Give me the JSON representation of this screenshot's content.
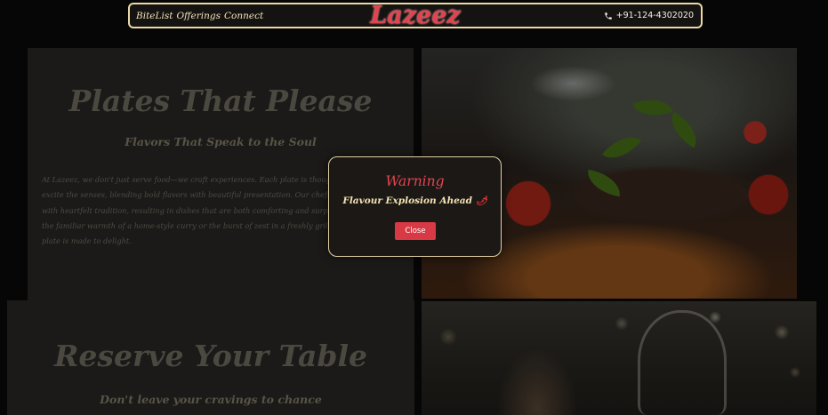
{
  "nav": {
    "links": [
      "BiteList",
      "Offerings",
      "Connect"
    ],
    "logo": "Lazeez",
    "phone": "+91-124-4302020"
  },
  "about": {
    "title": "Plates That Please",
    "subtitle": "Flavors That Speak to the Soul",
    "paragraph": "At Lazeez, we don't just serve food—we craft experiences. Each plate is thoughtfully prepared to excite the senses, blending bold flavors with beautiful presentation. Our chefs combine creativity with heartfelt tradition, resulting in dishes that are both comforting and surprising. Whether it's the familiar warmth of a home-style curry or the burst of zest in a freshly grilled appetizer, every plate is made to delight."
  },
  "reserve": {
    "title": "Reserve Your Table",
    "subtitle": "Don't leave your cravings to chance"
  },
  "modal": {
    "title": "Warning",
    "message": "Flavour Explosion Ahead",
    "icon": "chili-pepper-icon",
    "close_label": "Close"
  },
  "colors": {
    "accent": "#e2434f",
    "border": "#e9d9a6",
    "button": "#d83a45"
  }
}
